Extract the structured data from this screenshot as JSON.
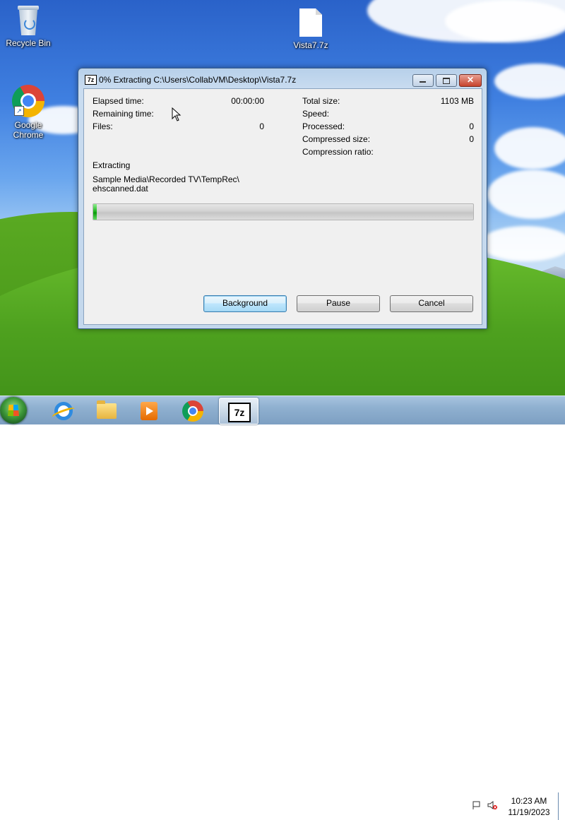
{
  "desktop": {
    "icons": [
      {
        "label": "Recycle Bin"
      },
      {
        "label": "Vista7.7z"
      },
      {
        "label": "Google Chrome"
      }
    ]
  },
  "window": {
    "app_icon_text": "7z",
    "title": "0% Extracting C:\\Users\\CollabVM\\Desktop\\Vista7.7z",
    "close_glyph": "✕",
    "stats_left": [
      {
        "label": "Elapsed time:",
        "value": "00:00:00"
      },
      {
        "label": "Remaining time:",
        "value": ""
      },
      {
        "label": "Files:",
        "value": "0"
      }
    ],
    "stats_right": [
      {
        "label": "Total size:",
        "value": "1103 MB"
      },
      {
        "label": "Speed:",
        "value": ""
      },
      {
        "label": "Processed:",
        "value": "0"
      },
      {
        "label": "Compressed size:",
        "value": "0"
      },
      {
        "label": "Compression ratio:",
        "value": ""
      }
    ],
    "status_heading": "Extracting",
    "current_file_line1": "Sample Media\\Recorded TV\\TempRec\\",
    "current_file_line2": "ehscanned.dat",
    "progress_percent": 0,
    "progress_color": "#18b018",
    "buttons": {
      "background": "Background",
      "pause": "Pause",
      "cancel": "Cancel"
    }
  },
  "taskbar": {
    "pinned": [
      "internet-explorer-icon",
      "file-explorer-icon",
      "media-player-icon",
      "chrome-icon",
      "7zip-icon"
    ],
    "active_app": "7zip-icon",
    "sevenzip_text": "7z",
    "clock_time": "10:23 AM",
    "clock_date": "11/19/2023"
  }
}
